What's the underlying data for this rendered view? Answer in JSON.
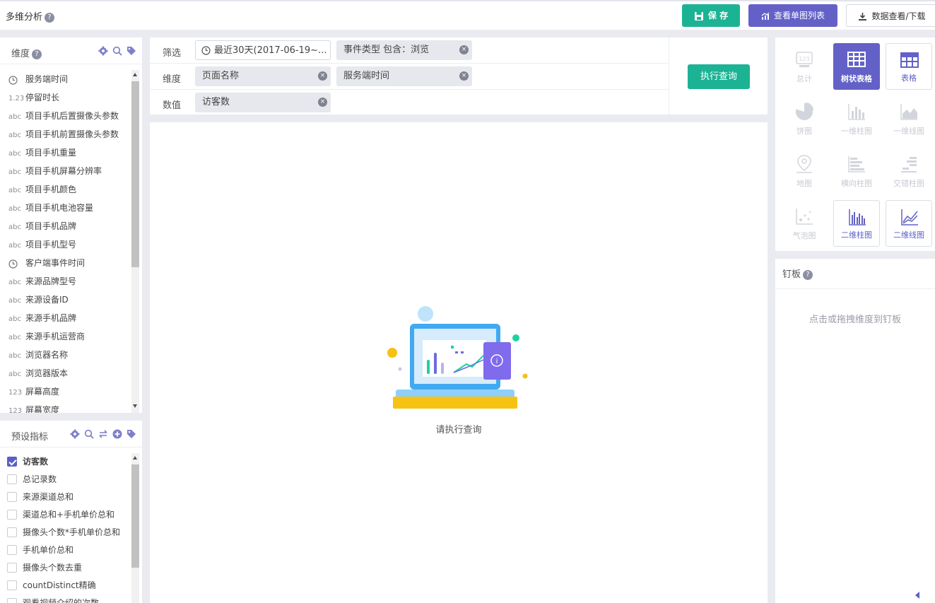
{
  "header": {
    "title": "多维分析",
    "help": "?",
    "save_label": "保 存",
    "chart_list_label": "查看单图列表",
    "download_label": "数据查看/下载"
  },
  "dimensions": {
    "title": "维度",
    "help": "?",
    "items": [
      {
        "type": "clock",
        "label": "服务端时间"
      },
      {
        "type": "1.23",
        "label": "停留时长"
      },
      {
        "type": "abc",
        "label": "项目手机后置摄像头参数"
      },
      {
        "type": "abc",
        "label": "项目手机前置摄像头参数"
      },
      {
        "type": "abc",
        "label": "项目手机重量"
      },
      {
        "type": "abc",
        "label": "项目手机屏幕分辨率"
      },
      {
        "type": "abc",
        "label": "项目手机颜色"
      },
      {
        "type": "abc",
        "label": "项目手机电池容量"
      },
      {
        "type": "abc",
        "label": "项目手机品牌"
      },
      {
        "type": "abc",
        "label": "项目手机型号"
      },
      {
        "type": "clock",
        "label": "客户端事件时间"
      },
      {
        "type": "abc",
        "label": "来源品牌型号"
      },
      {
        "type": "abc",
        "label": "来源设备ID"
      },
      {
        "type": "abc",
        "label": "来源手机品牌"
      },
      {
        "type": "abc",
        "label": "来源手机运营商"
      },
      {
        "type": "abc",
        "label": "浏览器名称"
      },
      {
        "type": "abc",
        "label": "浏览器版本"
      },
      {
        "type": "123",
        "label": "屏幕高度"
      },
      {
        "type": "123",
        "label": "屏幕宽度"
      }
    ]
  },
  "metrics": {
    "title": "预设指标",
    "items": [
      {
        "checked": true,
        "label": "访客数"
      },
      {
        "checked": false,
        "label": "总记录数"
      },
      {
        "checked": false,
        "label": "来源渠道总和"
      },
      {
        "checked": false,
        "label": "渠道总和+手机单价总和"
      },
      {
        "checked": false,
        "label": "摄像头个数*手机单价总和"
      },
      {
        "checked": false,
        "label": "手机单价总和"
      },
      {
        "checked": false,
        "label": "摄像头个数去重"
      },
      {
        "checked": false,
        "label": "countDistinct精确"
      },
      {
        "checked": false,
        "label": "观看视频介绍的次数"
      }
    ]
  },
  "query": {
    "filter_label": "筛选",
    "filter_date": "最近30天(2017-06-19~...",
    "filter_event": "事件类型 包含：浏览",
    "dimension_label": "维度",
    "dimension_values": [
      "页面名称",
      "服务端时间"
    ],
    "value_label": "数值",
    "value_values": [
      "访客数"
    ],
    "execute_label": "执行查询"
  },
  "result": {
    "empty_text": "请执行查询"
  },
  "chart_types": [
    {
      "name": "总计",
      "state": "disabled",
      "icon": "total-icon"
    },
    {
      "name": "树状表格",
      "state": "active",
      "icon": "tree-table-icon"
    },
    {
      "name": "表格",
      "state": "enabled",
      "icon": "table-icon"
    },
    {
      "name": "饼图",
      "state": "disabled",
      "icon": "pie-chart-icon"
    },
    {
      "name": "一维柱图",
      "state": "disabled",
      "icon": "bar-chart-icon"
    },
    {
      "name": "一维线图",
      "state": "disabled",
      "icon": "area-chart-icon"
    },
    {
      "name": "地图",
      "state": "disabled",
      "icon": "map-pin-icon"
    },
    {
      "name": "横向柱图",
      "state": "disabled",
      "icon": "horizontal-bar-icon"
    },
    {
      "name": "交错柱图",
      "state": "disabled",
      "icon": "staggered-bar-icon"
    },
    {
      "name": "气泡图",
      "state": "disabled",
      "icon": "bubble-chart-icon"
    },
    {
      "name": "二维柱图",
      "state": "selected",
      "icon": "bar-chart-2d-icon"
    },
    {
      "name": "二维线图",
      "state": "selected",
      "icon": "line-chart-2d-icon"
    }
  ],
  "pinboard": {
    "title": "钉板",
    "help": "?",
    "placeholder": "点击或拖拽维度到钉板"
  },
  "colors": {
    "green": "#1cb394",
    "purple": "#6361c7",
    "accent": "#5b5fc7"
  }
}
